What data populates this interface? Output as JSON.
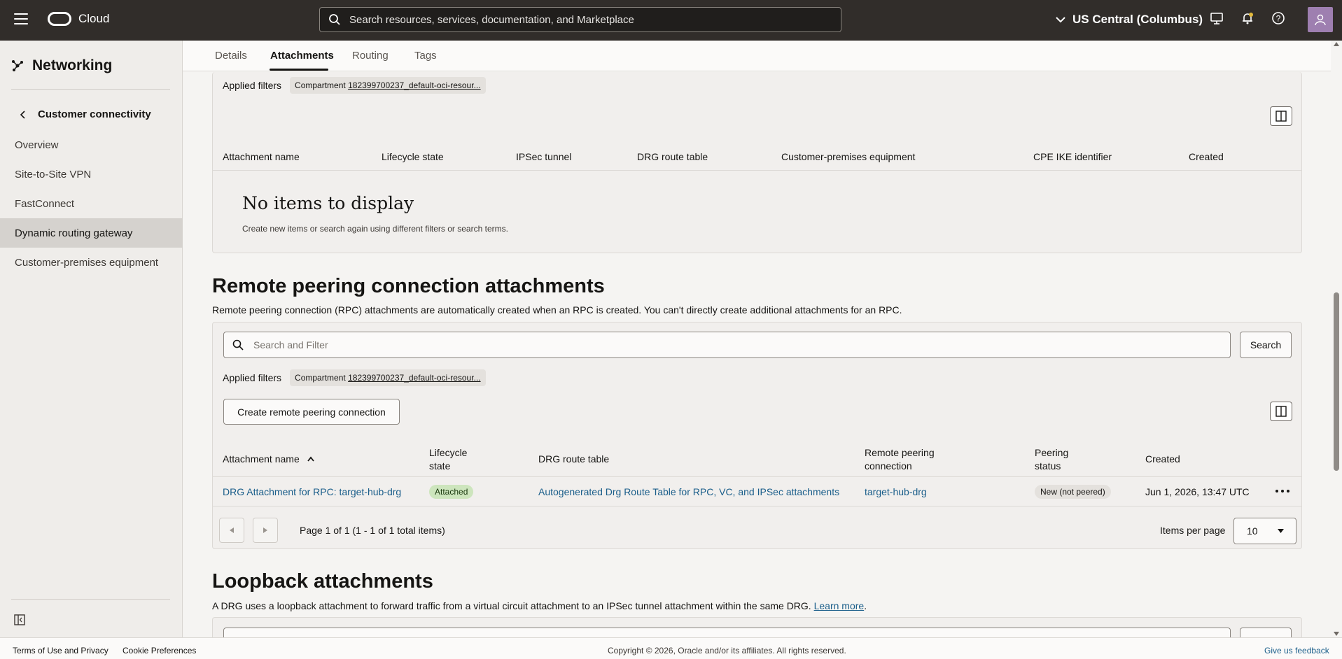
{
  "topbar": {
    "brand": "Cloud",
    "search_placeholder": "Search resources, services, documentation, and Marketplace",
    "region": "US Central (Columbus)"
  },
  "sidebar": {
    "title": "Networking",
    "back_label": "Customer connectivity",
    "items": [
      {
        "label": "Overview"
      },
      {
        "label": "Site-to-Site VPN"
      },
      {
        "label": "FastConnect"
      },
      {
        "label": "Dynamic routing gateway"
      },
      {
        "label": "Customer-premises equipment"
      }
    ]
  },
  "tabs": [
    "Details",
    "Attachments",
    "Routing",
    "Tags"
  ],
  "ipsec_section": {
    "applied_filters_label": "Applied filters",
    "chip_label": "Compartment",
    "chip_value": "182399700237_default-oci-resour...",
    "columns": [
      "Attachment name",
      "Lifecycle state",
      "IPSec tunnel",
      "DRG route table",
      "Customer-premises equipment",
      "CPE IKE identifier",
      "Created"
    ],
    "empty_title": "No items to display",
    "empty_sub": "Create new items or search again using different filters or search terms."
  },
  "rpc_section": {
    "title": "Remote peering connection attachments",
    "description": "Remote peering connection (RPC) attachments are automatically created when an RPC is created. You can't directly create additional attachments for an RPC.",
    "search_placeholder": "Search and Filter",
    "search_button": "Search",
    "applied_filters_label": "Applied filters",
    "chip_label": "Compartment",
    "chip_value": "182399700237_default-oci-resour...",
    "create_button": "Create remote peering connection",
    "columns": {
      "name": "Attachment name",
      "lifecycle_1": "Lifecycle",
      "lifecycle_2": "state",
      "route_table": "DRG route table",
      "rpc_1": "Remote peering",
      "rpc_2": "connection",
      "peering_1": "Peering",
      "peering_2": "status",
      "created": "Created"
    },
    "rows": [
      {
        "name": "DRG Attachment for RPC: target-hub-drg",
        "state": "Attached",
        "route_table": "Autogenerated Drg Route Table for RPC, VC, and IPSec attachments",
        "rpc": "target-hub-drg",
        "peering_status": "New (not peered)",
        "created": "Jun 1, 2026, 13:47 UTC"
      }
    ],
    "pager_text": "Page 1 of 1 (1 - 1 of 1 total items)",
    "items_per_page_label": "Items per page",
    "items_per_page_value": "10"
  },
  "loopback_section": {
    "title": "Loopback attachments",
    "description": "A DRG uses a loopback attachment to forward traffic from a virtual circuit attachment to an IPSec tunnel attachment within the same DRG.",
    "learn_more": "Learn more",
    "period": "."
  },
  "footer": {
    "terms": "Terms of Use and Privacy",
    "cookies": "Cookie Preferences",
    "copyright": "Copyright © 2026, Oracle and/or its affiliates. All rights reserved.",
    "feedback": "Give us feedback"
  }
}
